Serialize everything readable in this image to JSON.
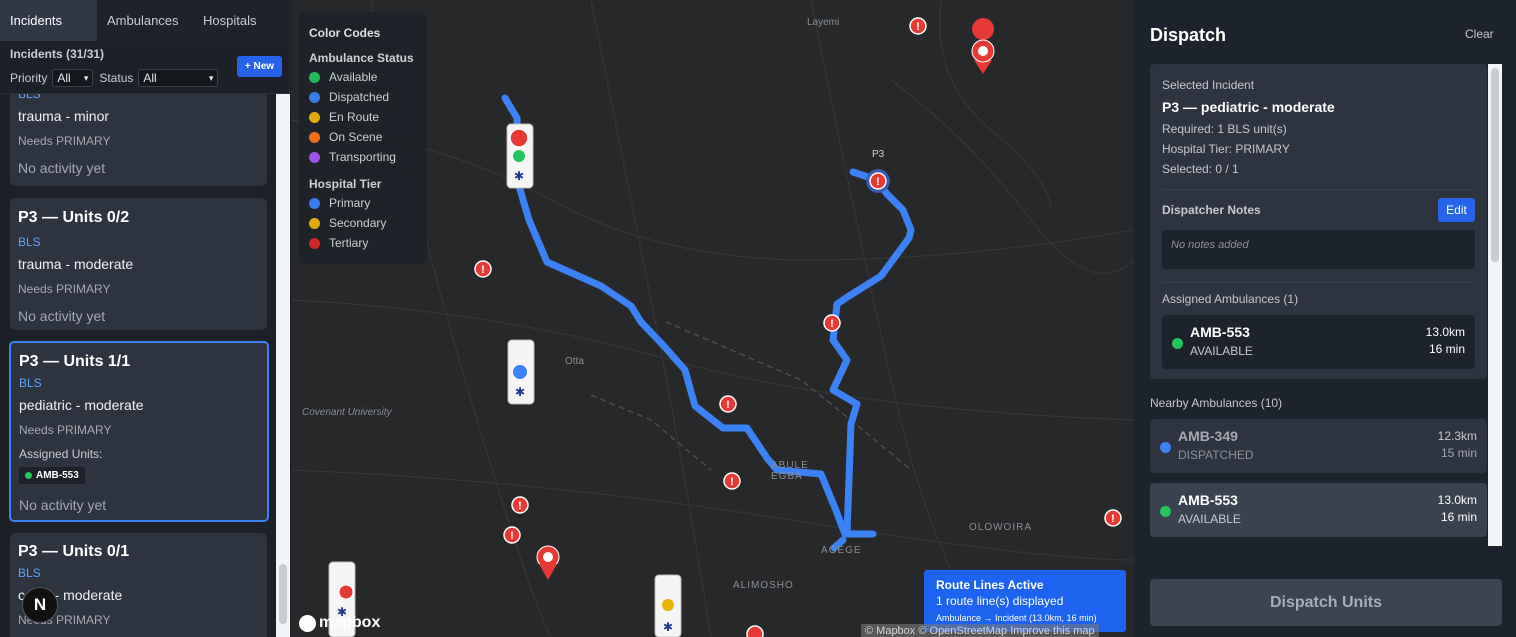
{
  "tabs": [
    "Incidents",
    "Ambulances",
    "Hospitals"
  ],
  "left": {
    "count_label": "Incidents (31/31)",
    "priority_label": "Priority",
    "priority_value": "All",
    "status_label": "Status",
    "status_value": "All",
    "new_button": "+ New",
    "cards": [
      {
        "type": "BLS",
        "desc": "trauma - minor",
        "need": "Needs PRIMARY",
        "activity": "No activity yet"
      },
      {
        "title": "P3 — Units 0/2",
        "type": "BLS",
        "desc": "trauma - moderate",
        "need": "Needs PRIMARY",
        "activity": "No activity yet"
      },
      {
        "title": "P3 — Units 1/1",
        "type": "BLS",
        "desc": "pediatric - moderate",
        "need": "Needs PRIMARY",
        "assigned_label": "Assigned Units:",
        "unit": "AMB-553",
        "activity": "No activity yet"
      },
      {
        "title": "P3 — Units 0/1",
        "type": "BLS",
        "desc": "c    ic - moderate",
        "need": "Needs PRIMARY"
      }
    ],
    "n_badge": "N"
  },
  "map": {
    "legend": {
      "title": "Color Codes",
      "ambulance_title": "Ambulance Status",
      "ambulance_items": [
        {
          "label": "Available",
          "color": "#22c55e"
        },
        {
          "label": "Dispatched",
          "color": "#3b82f6"
        },
        {
          "label": "En Route",
          "color": "#eab308"
        },
        {
          "label": "On Scene",
          "color": "#f97316"
        },
        {
          "label": "Transporting",
          "color": "#a855f7"
        }
      ],
      "hospital_title": "Hospital Tier",
      "hospital_items": [
        {
          "label": "Primary",
          "color": "#3b82f6"
        },
        {
          "label": "Secondary",
          "color": "#eab308"
        },
        {
          "label": "Tertiary",
          "color": "#dc2626"
        }
      ]
    },
    "place_labels": {
      "layemi": "Layemi",
      "otta": "Otta",
      "covenant": "Covenant University",
      "abule_egba": "ABULE EGBA",
      "agege": "AGEGE",
      "alimosho": "ALIMOSHO",
      "olowoira": "OLOWOIRA"
    },
    "pin_label": "P3",
    "route_box": {
      "title": "Route Lines Active",
      "count": "1 route line(s) displayed",
      "detail": "Ambulance → Incident (13.0km, 16 min)"
    },
    "mapbox_logo": "mapbox",
    "attribution": "© Mapbox © OpenStreetMap Improve this map"
  },
  "dispatch": {
    "title": "Dispatch",
    "clear": "Clear",
    "selected_label": "Selected Incident",
    "selected_title": "P3 — pediatric - moderate",
    "required": "Required: 1 BLS unit(s)",
    "tier": "Hospital Tier: PRIMARY",
    "selected_count": "Selected: 0 / 1",
    "notes_label": "Dispatcher Notes",
    "edit": "Edit",
    "notes_placeholder": "No notes added",
    "assigned_label": "Assigned Ambulances (1)",
    "assigned": [
      {
        "name": "AMB-553",
        "status": "AVAILABLE",
        "dist": "13.0km",
        "eta": "16 min",
        "color": "#22c55e"
      }
    ],
    "nearby_label": "Nearby Ambulances (10)",
    "nearby": [
      {
        "name": "AMB-349",
        "status": "DISPATCHED",
        "dist": "12.3km",
        "eta": "15 min",
        "color": "#3b82f6"
      },
      {
        "name": "AMB-553",
        "status": "AVAILABLE",
        "dist": "13.0km",
        "eta": "16 min",
        "color": "#22c55e"
      }
    ],
    "dispatch_button": "Dispatch Units"
  }
}
